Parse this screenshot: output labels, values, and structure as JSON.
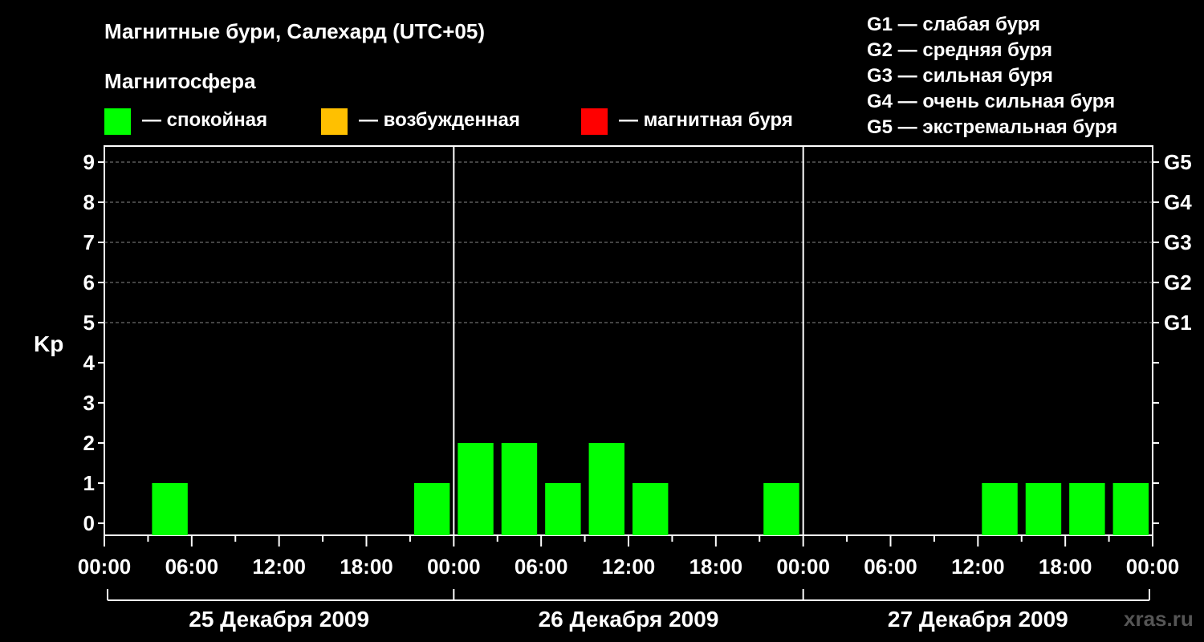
{
  "chart_data": {
    "type": "bar",
    "title": "Магнитные бури, Салехард (UTC+05)",
    "legend_title": "Магнитосфера",
    "legend": [
      {
        "label": "— спокойная",
        "color": "#00ff00"
      },
      {
        "label": "— возбужденная",
        "color": "#ffc000"
      },
      {
        "label": "— магнитная буря",
        "color": "#ff0000"
      }
    ],
    "storm_scale": [
      "G1 — слабая буря",
      "G2 — средняя буря",
      "G3 — сильная буря",
      "G4 — очень сильная буря",
      "G5 — экстремальная буря"
    ],
    "ylabel": "Kp",
    "ylim": [
      0,
      9
    ],
    "y_ticks": [
      "0",
      "1",
      "2",
      "3",
      "4",
      "5",
      "6",
      "7",
      "8",
      "9"
    ],
    "right_ticks": [
      {
        "kp": 5,
        "label": "G1"
      },
      {
        "kp": 6,
        "label": "G2"
      },
      {
        "kp": 7,
        "label": "G3"
      },
      {
        "kp": 8,
        "label": "G4"
      },
      {
        "kp": 9,
        "label": "G5"
      }
    ],
    "x_tick_labels": [
      "00:00",
      "06:00",
      "12:00",
      "18:00",
      "00:00",
      "06:00",
      "12:00",
      "18:00",
      "00:00",
      "06:00",
      "12:00",
      "18:00",
      "00:00"
    ],
    "days": [
      "25 Декабря 2009",
      "26 Декабря 2009",
      "27 Декабря 2009"
    ],
    "interval_hours": 3,
    "grid": "dashed horizontal at Kp 5-9",
    "series": [
      {
        "values": [
          0,
          1,
          0,
          0,
          0,
          0,
          0,
          1,
          2,
          2,
          1,
          2,
          1,
          0,
          0,
          1,
          0,
          0,
          0,
          0,
          1,
          1,
          1,
          1
        ]
      }
    ]
  },
  "watermark": "xras.ru"
}
